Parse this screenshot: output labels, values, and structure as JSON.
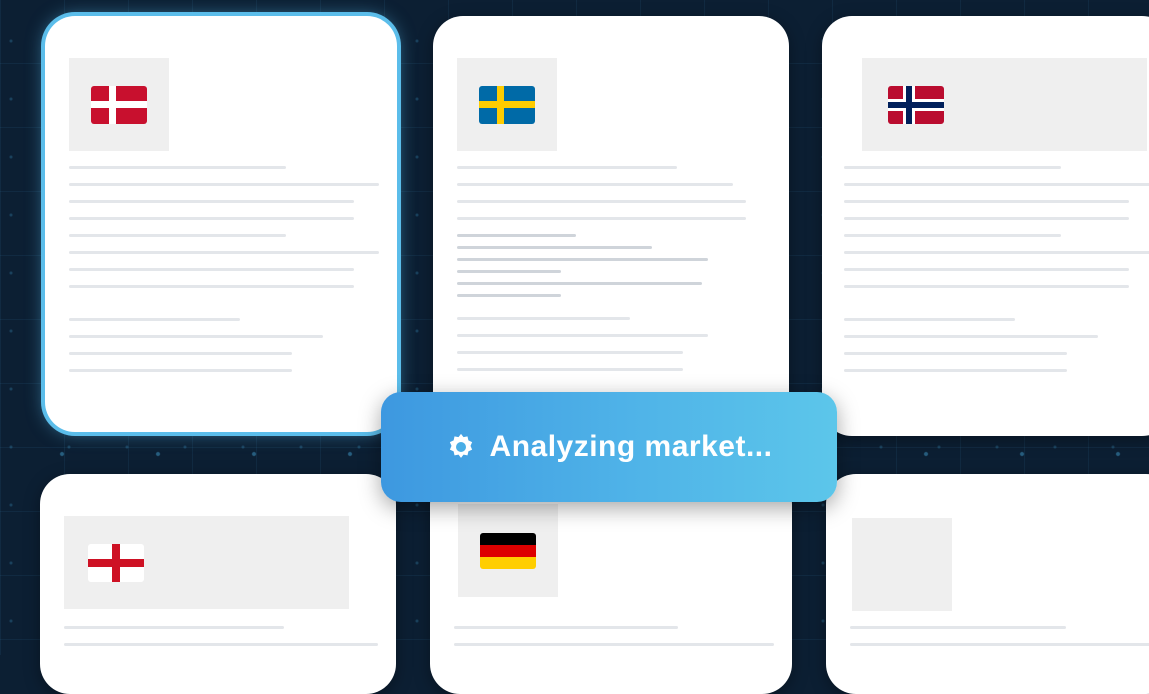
{
  "status_toast": {
    "text": "Analyzing market...",
    "icon": "gear-icon"
  },
  "cards": [
    {
      "flag": "denmark-flag-icon"
    },
    {
      "flag": "sweden-flag-icon"
    },
    {
      "flag": "norway-flag-icon"
    },
    {
      "flag": "england-flag-icon"
    },
    {
      "flag": "germany-flag-icon"
    },
    {
      "flag": "none"
    }
  ],
  "colors": {
    "background": "#0c1f33",
    "card": "#ffffff",
    "highlight": "#5bbdea",
    "toast_start": "#3d98e0",
    "toast_end": "#5cc6ea",
    "text_placeholder": "#e3e6ea"
  }
}
